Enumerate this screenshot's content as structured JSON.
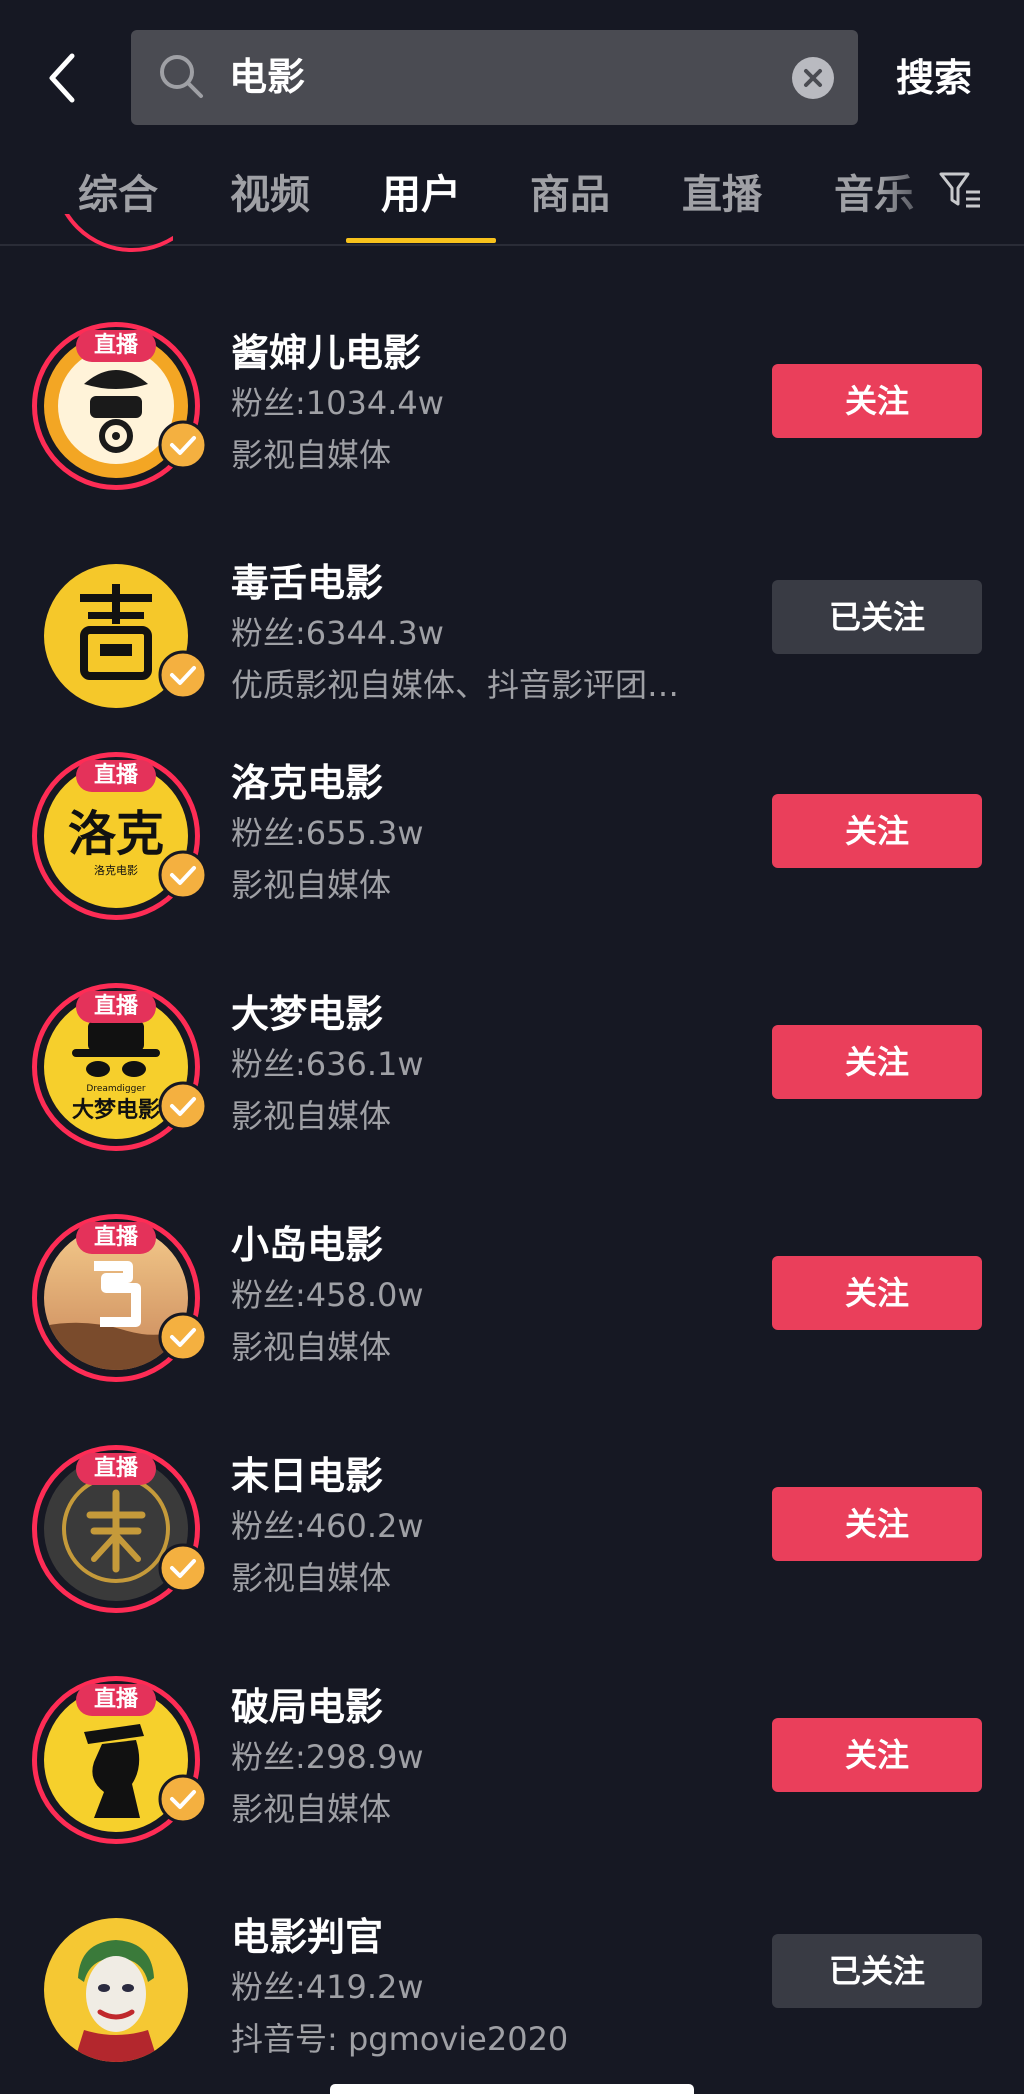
{
  "header": {
    "search_query": "电影",
    "search_button": "搜索"
  },
  "icons": {
    "back": "chevron-left-icon",
    "search": "search-icon",
    "clear": "close-circle-icon",
    "filter": "filter-icon",
    "verified": "check-circle-icon"
  },
  "colors": {
    "background": "#161823",
    "accent_tab": "#f8c21c",
    "follow": "#ea3f5b",
    "followed": "#393b44",
    "live_ring": "#fe2c55",
    "verified": "#f4b040"
  },
  "tabs": [
    {
      "label": "综合"
    },
    {
      "label": "视频"
    },
    {
      "label": "用户"
    },
    {
      "label": "商品"
    },
    {
      "label": "直播"
    },
    {
      "label": "音乐"
    }
  ],
  "active_tab": "用户",
  "users": [
    {
      "name": "酱婶儿电影",
      "fans": "粉丝:1034.4w",
      "desc": "影视自媒体",
      "live": "直播",
      "follow": "关注"
    },
    {
      "name": "毒舌电影",
      "fans": "粉丝:6344.3w",
      "desc": "优质影视自媒体、抖音影评团…",
      "follow": "已关注"
    },
    {
      "name": "洛克电影",
      "fans": "粉丝:655.3w",
      "desc": "影视自媒体",
      "live": "直播",
      "follow": "关注",
      "avatar_text": "洛克",
      "avatar_subtext": "洛克电影"
    },
    {
      "name": "大梦电影",
      "fans": "粉丝:636.1w",
      "desc": "影视自媒体",
      "live": "直播",
      "follow": "关注",
      "avatar_text": "大梦电影",
      "avatar_subtext": "Dreamdigger"
    },
    {
      "name": "小岛电影",
      "fans": "粉丝:458.0w",
      "desc": "影视自媒体",
      "live": "直播",
      "follow": "关注"
    },
    {
      "name": "末日电影",
      "fans": "粉丝:460.2w",
      "desc": "影视自媒体",
      "live": "直播",
      "follow": "关注"
    },
    {
      "name": "破局电影",
      "fans": "粉丝:298.9w",
      "desc": "影视自媒体",
      "live": "直播",
      "follow": "关注"
    },
    {
      "name": "电影判官",
      "fans": "粉丝:419.2w",
      "desc": "抖音号: pgmovie2020",
      "follow": "已关注"
    }
  ]
}
